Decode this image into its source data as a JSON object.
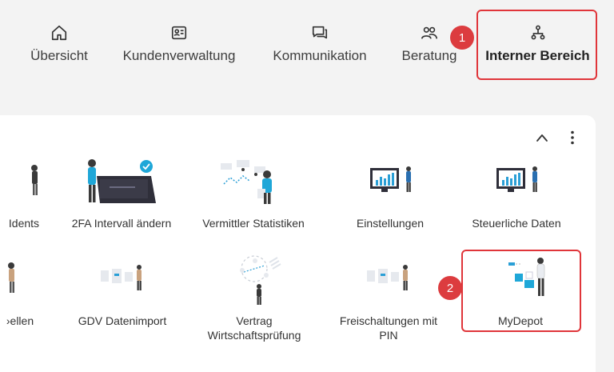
{
  "nav": {
    "items": [
      {
        "label": "Übersicht",
        "icon": "home-icon"
      },
      {
        "label": "Kundenverwaltung",
        "icon": "contact-card-icon"
      },
      {
        "label": "Kommunikation",
        "icon": "chat-icon"
      },
      {
        "label": "Beratung",
        "icon": "people-icon"
      },
      {
        "label": "Interner Bereich",
        "icon": "org-tree-icon"
      }
    ],
    "active": "Interner Bereich"
  },
  "steps": [
    "1",
    "2"
  ],
  "card": {
    "collapse_icon": "chevron-up-icon",
    "menu_icon": "more-vertical-icon",
    "tiles": [
      {
        "label": "Idents"
      },
      {
        "label": "2FA Intervall ändern"
      },
      {
        "label": "Vermittler Statistiken"
      },
      {
        "label": "Einstellungen"
      },
      {
        "label": "Steuerliche Daten"
      },
      {
        "label": "›ellen"
      },
      {
        "label": "GDV Datenimport"
      },
      {
        "label": "Vertrag\nWirtschaftsprüfung"
      },
      {
        "label": "Freischaltungen mit\nPIN"
      },
      {
        "label": "MyDepot"
      }
    ]
  },
  "colors": {
    "highlight": "#e0353a",
    "badge": "#dc3c3f",
    "accent": "#1fa7d8",
    "chart": "#2a9fd6"
  }
}
